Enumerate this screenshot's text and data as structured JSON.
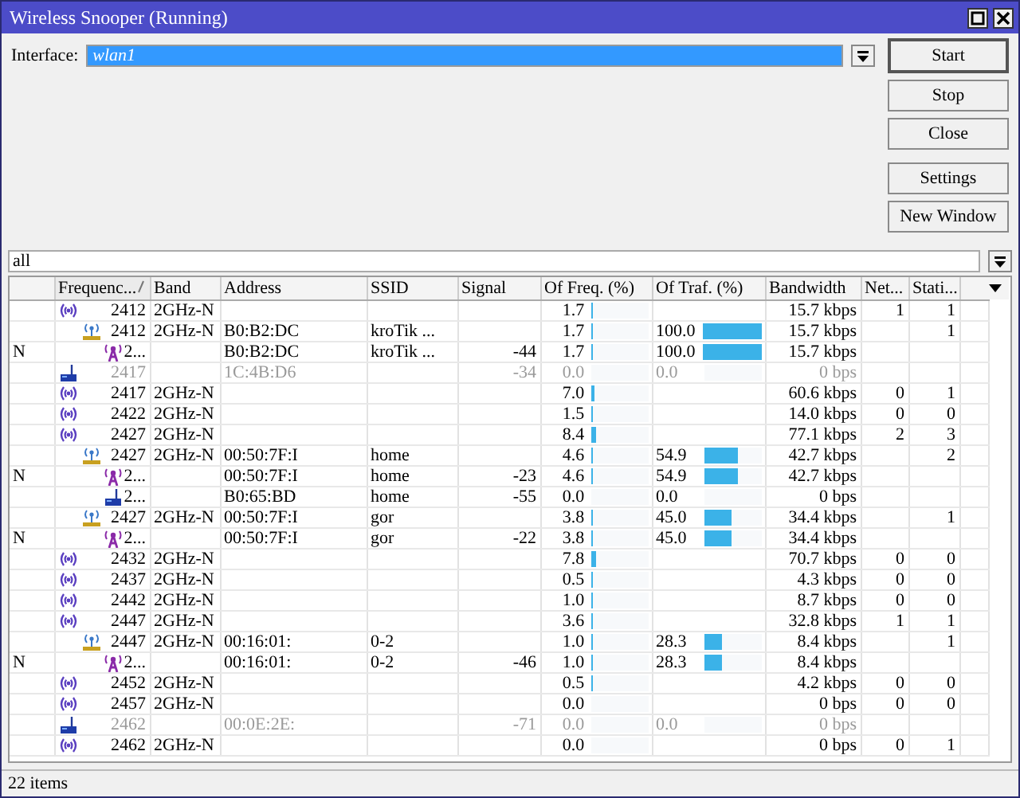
{
  "window": {
    "title": "Wireless Snooper (Running)"
  },
  "interface": {
    "label": "Interface:",
    "value": "wlan1"
  },
  "button_groups": [
    [
      {
        "label": "Start",
        "default": true
      },
      {
        "label": "Stop",
        "default": false
      },
      {
        "label": "Close",
        "default": false
      }
    ],
    [
      {
        "label": "Settings",
        "default": false
      },
      {
        "label": "New Window",
        "default": false
      }
    ]
  ],
  "filter": {
    "value": "all"
  },
  "table": {
    "columns": [
      {
        "sorted": false
      },
      {
        "label": "Frequenc...",
        "sorted": true
      },
      {
        "label": "Band",
        "sorted": false
      },
      {
        "label": "Address",
        "sorted": false
      },
      {
        "label": "SSID",
        "sorted": false
      },
      {
        "label": "Signal",
        "sorted": false
      },
      {
        "label": "Of Freq. (%)",
        "sorted": false
      },
      {
        "label": "Of Traf. (%)",
        "sorted": false
      },
      {
        "label": "Bandwidth",
        "sorted": false
      },
      {
        "label": "Net...",
        "sorted": false
      },
      {
        "label": "Stati...",
        "sorted": false
      }
    ],
    "rows": [
      {
        "kind": "frequency",
        "dimmed": false,
        "frequency": "2412",
        "band": "2GHz-N",
        "of_freq": {
          "text": "1.7",
          "level": 0.017
        },
        "bandwidth": "15.7 kbps",
        "networks": "1",
        "stations": "1",
        "children": [
          {
            "kind": "network",
            "dimmed": false,
            "frequency": "2412",
            "band": "2GHz-N",
            "address": "B0:B2:DC",
            "ssid": "kroTik ...",
            "of_freq": {
              "text": "1.7",
              "level": 0.017
            },
            "of_traf": {
              "text": "100.0",
              "level": 1.0
            },
            "bandwidth": "15.7 kbps",
            "stations": "1",
            "children": [
              {
                "kind": "access-point",
                "dimmed": false,
                "flag": "N",
                "frequency": "2...",
                "address": "B0:B2:DC",
                "ssid": "kroTik ...",
                "signal": "-44",
                "of_freq": {
                  "text": "1.7",
                  "level": 0.017
                },
                "of_traf": {
                  "text": "100.0",
                  "level": 1.0
                },
                "bandwidth": "15.7 kbps"
              }
            ]
          }
        ]
      },
      {
        "kind": "station",
        "dimmed": true,
        "frequency": "2417",
        "address": "1C:4B:D6",
        "signal": "-34",
        "of_freq": {
          "text": "0.0",
          "level": 0
        },
        "of_traf": {
          "text": "0.0",
          "level": 0
        },
        "bandwidth": "0 bps"
      },
      {
        "kind": "frequency",
        "dimmed": false,
        "frequency": "2417",
        "band": "2GHz-N",
        "of_freq": {
          "text": "7.0",
          "level": 0.07
        },
        "bandwidth": "60.6 kbps",
        "networks": "0",
        "stations": "1"
      },
      {
        "kind": "frequency",
        "dimmed": false,
        "frequency": "2422",
        "band": "2GHz-N",
        "of_freq": {
          "text": "1.5",
          "level": 0.015
        },
        "bandwidth": "14.0 kbps",
        "networks": "0",
        "stations": "0"
      },
      {
        "kind": "frequency",
        "dimmed": false,
        "frequency": "2427",
        "band": "2GHz-N",
        "of_freq": {
          "text": "8.4",
          "level": 0.084
        },
        "bandwidth": "77.1 kbps",
        "networks": "2",
        "stations": "3",
        "children": [
          {
            "kind": "network",
            "dimmed": false,
            "frequency": "2427",
            "band": "2GHz-N",
            "address": "00:50:7F:I",
            "ssid": "home",
            "of_freq": {
              "text": "4.6",
              "level": 0.046
            },
            "of_traf": {
              "text": "54.9",
              "level": 0.549
            },
            "bandwidth": "42.7 kbps",
            "stations": "2",
            "children": [
              {
                "kind": "access-point",
                "dimmed": false,
                "flag": "N",
                "frequency": "2...",
                "address": "00:50:7F:I",
                "ssid": "home",
                "signal": "-23",
                "of_freq": {
                  "text": "4.6",
                  "level": 0.046
                },
                "of_traf": {
                  "text": "54.9",
                  "level": 0.549
                },
                "bandwidth": "42.7 kbps"
              },
              {
                "kind": "station",
                "dimmed": false,
                "frequency": "2...",
                "address": "B0:65:BD",
                "ssid": "home",
                "signal": "-55",
                "of_freq": {
                  "text": "0.0",
                  "level": 0
                },
                "of_traf": {
                  "text": "0.0",
                  "level": 0
                },
                "bandwidth": "0 bps"
              }
            ]
          },
          {
            "kind": "network",
            "dimmed": false,
            "frequency": "2427",
            "band": "2GHz-N",
            "address": "00:50:7F:I",
            "ssid": "gor",
            "of_freq": {
              "text": "3.8",
              "level": 0.038
            },
            "of_traf": {
              "text": "45.0",
              "level": 0.45
            },
            "bandwidth": "34.4 kbps",
            "stations": "1",
            "children": [
              {
                "kind": "access-point",
                "dimmed": false,
                "flag": "N",
                "frequency": "2...",
                "address": "00:50:7F:I",
                "ssid": "gor",
                "signal": "-22",
                "of_freq": {
                  "text": "3.8",
                  "level": 0.038
                },
                "of_traf": {
                  "text": "45.0",
                  "level": 0.45
                },
                "bandwidth": "34.4 kbps"
              }
            ]
          }
        ]
      },
      {
        "kind": "frequency",
        "dimmed": false,
        "frequency": "2432",
        "band": "2GHz-N",
        "of_freq": {
          "text": "7.8",
          "level": 0.078
        },
        "bandwidth": "70.7 kbps",
        "networks": "0",
        "stations": "0"
      },
      {
        "kind": "frequency",
        "dimmed": false,
        "frequency": "2437",
        "band": "2GHz-N",
        "of_freq": {
          "text": "0.5",
          "level": 0.005
        },
        "bandwidth": "4.3 kbps",
        "networks": "0",
        "stations": "0"
      },
      {
        "kind": "frequency",
        "dimmed": false,
        "frequency": "2442",
        "band": "2GHz-N",
        "of_freq": {
          "text": "1.0",
          "level": 0.01
        },
        "bandwidth": "8.7 kbps",
        "networks": "0",
        "stations": "0"
      },
      {
        "kind": "frequency",
        "dimmed": false,
        "frequency": "2447",
        "band": "2GHz-N",
        "of_freq": {
          "text": "3.6",
          "level": 0.036
        },
        "bandwidth": "32.8 kbps",
        "networks": "1",
        "stations": "1",
        "children": [
          {
            "kind": "network",
            "dimmed": false,
            "frequency": "2447",
            "band": "2GHz-N",
            "address": "00:16:01:",
            "ssid": "0-2",
            "of_freq": {
              "text": "1.0",
              "level": 0.01
            },
            "of_traf": {
              "text": "28.3",
              "level": 0.283
            },
            "bandwidth": "8.4 kbps",
            "stations": "1",
            "children": [
              {
                "kind": "access-point",
                "dimmed": false,
                "flag": "N",
                "frequency": "2...",
                "address": "00:16:01:",
                "ssid": "0-2",
                "signal": "-46",
                "of_freq": {
                  "text": "1.0",
                  "level": 0.01
                },
                "of_traf": {
                  "text": "28.3",
                  "level": 0.283
                },
                "bandwidth": "8.4 kbps"
              }
            ]
          }
        ]
      },
      {
        "kind": "frequency",
        "dimmed": false,
        "frequency": "2452",
        "band": "2GHz-N",
        "of_freq": {
          "text": "0.5",
          "level": 0.005
        },
        "bandwidth": "4.2 kbps",
        "networks": "0",
        "stations": "0"
      },
      {
        "kind": "frequency",
        "dimmed": false,
        "frequency": "2457",
        "band": "2GHz-N",
        "of_freq": {
          "text": "0.0",
          "level": 0
        },
        "bandwidth": "0 bps",
        "networks": "0",
        "stations": "0"
      },
      {
        "kind": "station",
        "dimmed": true,
        "frequency": "2462",
        "address": "00:0E:2E:",
        "signal": "-71",
        "of_freq": {
          "text": "0.0",
          "level": 0
        },
        "of_traf": {
          "text": "0.0",
          "level": 0
        },
        "bandwidth": "0 bps"
      },
      {
        "kind": "frequency",
        "dimmed": false,
        "frequency": "2462",
        "band": "2GHz-N",
        "of_freq": {
          "text": "0.0",
          "level": 0
        },
        "bandwidth": "0 bps",
        "networks": "0",
        "stations": "1"
      }
    ]
  },
  "status_bar": {
    "text": "22 items"
  }
}
